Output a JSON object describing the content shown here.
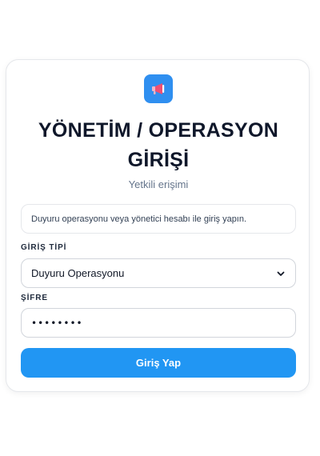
{
  "login": {
    "title_line1": "YÖNETİM / OPERASYON",
    "title_line2": "GİRİŞİ",
    "subtitle": "Yetkili erişimi",
    "notice": "Duyuru operasyonu veya yönetici hesabı ile giriş yapın.",
    "type_label": "GİRİŞ TİPİ",
    "type_selected": "Duyuru Operasyonu",
    "password_label": "ŞİFRE",
    "password_value": "••••••••",
    "submit_label": "Giriş Yap"
  },
  "icons": {
    "logo": "megaphone-icon",
    "select_arrow": "chevron-down-icon"
  },
  "colors": {
    "accent": "#2196f3",
    "logo_bg": "#2f8ff0",
    "megaphone": "#ef4f73",
    "title": "#0f172a",
    "muted": "#64748b"
  }
}
